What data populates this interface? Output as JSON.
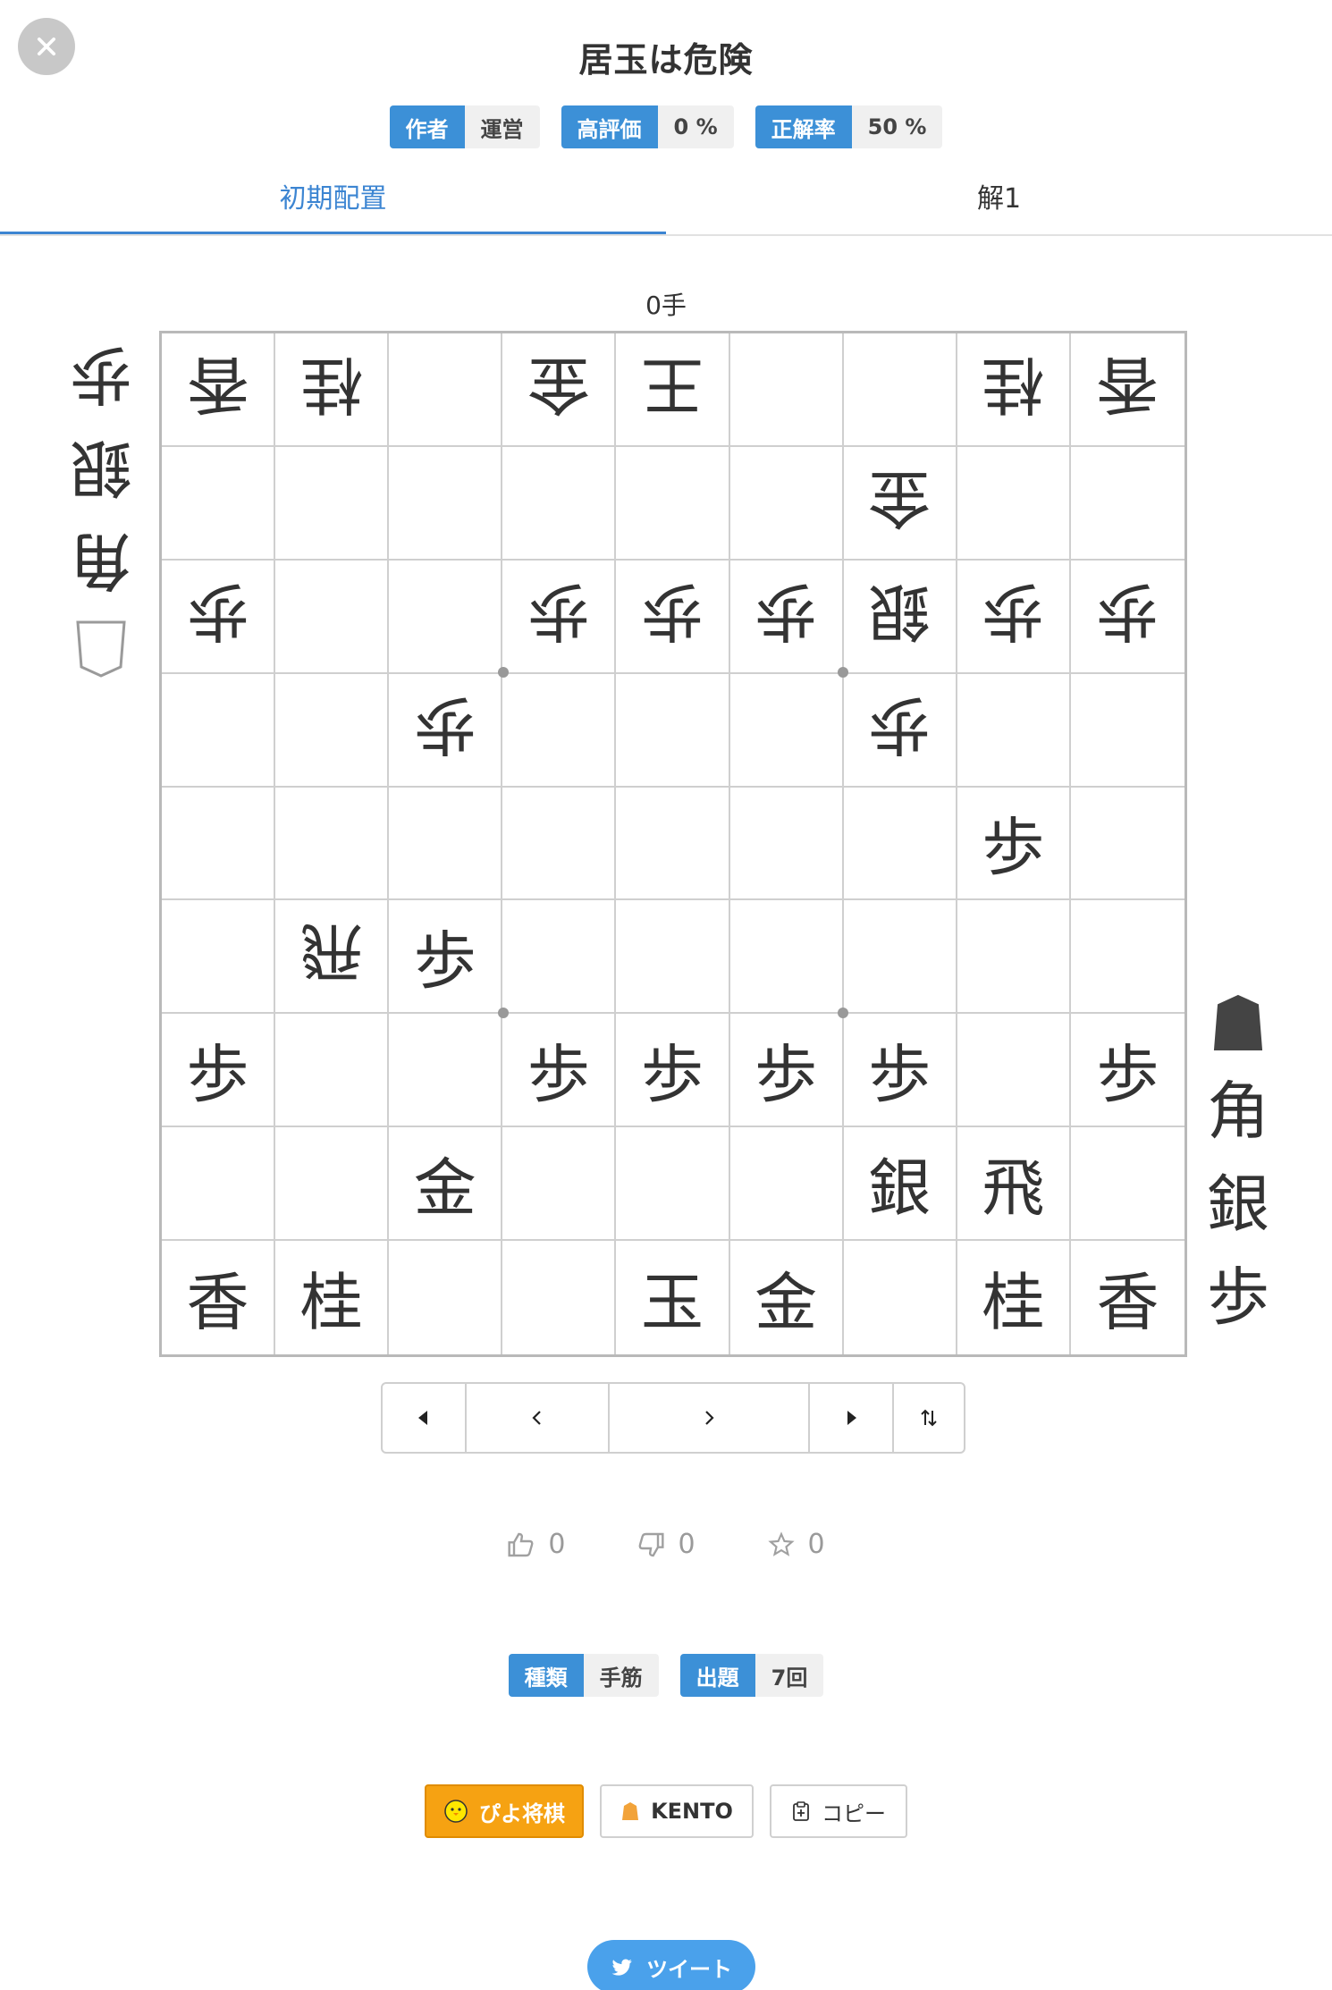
{
  "header": {
    "title": "居玉は危険",
    "tags": [
      {
        "key": "作者",
        "value": "運営"
      },
      {
        "key": "高評価",
        "value": "0 %"
      },
      {
        "key": "正解率",
        "value": "50 %"
      }
    ]
  },
  "tabs": [
    {
      "label": "初期配置",
      "active": true
    },
    {
      "label": "解1",
      "active": false
    }
  ],
  "move_count": "0手",
  "board": [
    [
      {
        "p": "香",
        "gote": true
      },
      {
        "p": "桂",
        "gote": true
      },
      {
        "p": "",
        "gote": false
      },
      {
        "p": "金",
        "gote": true
      },
      {
        "p": "王",
        "gote": true
      },
      {
        "p": "",
        "gote": false
      },
      {
        "p": "",
        "gote": false
      },
      {
        "p": "桂",
        "gote": true
      },
      {
        "p": "香",
        "gote": true
      }
    ],
    [
      {
        "p": "",
        "gote": false
      },
      {
        "p": "",
        "gote": false
      },
      {
        "p": "",
        "gote": false
      },
      {
        "p": "",
        "gote": false
      },
      {
        "p": "",
        "gote": false
      },
      {
        "p": "",
        "gote": false
      },
      {
        "p": "金",
        "gote": true
      },
      {
        "p": "",
        "gote": false
      },
      {
        "p": "",
        "gote": false
      }
    ],
    [
      {
        "p": "歩",
        "gote": true
      },
      {
        "p": "",
        "gote": false
      },
      {
        "p": "",
        "gote": false
      },
      {
        "p": "歩",
        "gote": true
      },
      {
        "p": "歩",
        "gote": true
      },
      {
        "p": "歩",
        "gote": true
      },
      {
        "p": "銀",
        "gote": true
      },
      {
        "p": "歩",
        "gote": true
      },
      {
        "p": "歩",
        "gote": true
      }
    ],
    [
      {
        "p": "",
        "gote": false
      },
      {
        "p": "",
        "gote": false
      },
      {
        "p": "歩",
        "gote": true
      },
      {
        "p": "",
        "gote": false
      },
      {
        "p": "",
        "gote": false
      },
      {
        "p": "",
        "gote": false
      },
      {
        "p": "歩",
        "gote": true
      },
      {
        "p": "",
        "gote": false
      },
      {
        "p": "",
        "gote": false
      }
    ],
    [
      {
        "p": "",
        "gote": false
      },
      {
        "p": "",
        "gote": false
      },
      {
        "p": "",
        "gote": false
      },
      {
        "p": "",
        "gote": false
      },
      {
        "p": "",
        "gote": false
      },
      {
        "p": "",
        "gote": false
      },
      {
        "p": "",
        "gote": false
      },
      {
        "p": "歩",
        "gote": false
      },
      {
        "p": "",
        "gote": false
      }
    ],
    [
      {
        "p": "",
        "gote": false
      },
      {
        "p": "飛",
        "gote": true
      },
      {
        "p": "歩",
        "gote": false
      },
      {
        "p": "",
        "gote": false
      },
      {
        "p": "",
        "gote": false
      },
      {
        "p": "",
        "gote": false
      },
      {
        "p": "",
        "gote": false
      },
      {
        "p": "",
        "gote": false
      },
      {
        "p": "",
        "gote": false
      }
    ],
    [
      {
        "p": "歩",
        "gote": false
      },
      {
        "p": "",
        "gote": false
      },
      {
        "p": "",
        "gote": false
      },
      {
        "p": "歩",
        "gote": false
      },
      {
        "p": "歩",
        "gote": false
      },
      {
        "p": "歩",
        "gote": false
      },
      {
        "p": "歩",
        "gote": false
      },
      {
        "p": "",
        "gote": false
      },
      {
        "p": "歩",
        "gote": false
      }
    ],
    [
      {
        "p": "",
        "gote": false
      },
      {
        "p": "",
        "gote": false
      },
      {
        "p": "金",
        "gote": false
      },
      {
        "p": "",
        "gote": false
      },
      {
        "p": "",
        "gote": false
      },
      {
        "p": "",
        "gote": false
      },
      {
        "p": "銀",
        "gote": false
      },
      {
        "p": "飛",
        "gote": false
      },
      {
        "p": "",
        "gote": false
      }
    ],
    [
      {
        "p": "香",
        "gote": false
      },
      {
        "p": "桂",
        "gote": false
      },
      {
        "p": "",
        "gote": false
      },
      {
        "p": "",
        "gote": false
      },
      {
        "p": "玉",
        "gote": false
      },
      {
        "p": "金",
        "gote": false
      },
      {
        "p": "",
        "gote": false
      },
      {
        "p": "桂",
        "gote": false
      },
      {
        "p": "香",
        "gote": false
      }
    ]
  ],
  "gote_hand": [
    "歩",
    "銀",
    "角"
  ],
  "sente_hand": [
    "角",
    "銀",
    "歩"
  ],
  "ratings": {
    "good": "0",
    "bad": "0",
    "favorite": "0"
  },
  "info_tags": [
    {
      "key": "種類",
      "value": "手筋"
    },
    {
      "key": "出題",
      "value": "7回"
    }
  ],
  "actions": {
    "piyo": "ぴよ将棋",
    "kento": "KENTO",
    "copy": "コピー"
  },
  "tweet": "ツイート",
  "colors": {
    "accent": "#3c90d7",
    "piyo": "#f6a212",
    "twitter": "#4aa1eb"
  }
}
